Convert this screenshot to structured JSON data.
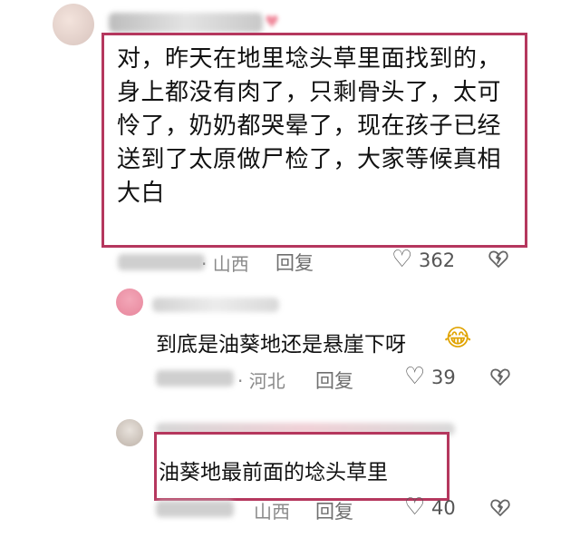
{
  "comments": [
    {
      "text": "对，昨天在地里埝头草里面找到的，身上都没有肉了，只剩骨头了，太可怜了，奶奶都哭晕了，现在孩子已经送到了太原做尸检了，大家等候真相大白",
      "location": "· 山西",
      "reply_label": "回复",
      "likes": "362",
      "like_icon": "heart-icon",
      "dislike_icon": "broken-heart-icon"
    },
    {
      "text": "到底是油葵地还是悬崖下呀",
      "emoji": "😂",
      "location": "· 河北",
      "reply_label": "回复",
      "likes": "39",
      "like_icon": "heart-icon",
      "dislike_icon": "broken-heart-icon"
    },
    {
      "text": "油葵地最前面的埝头草里",
      "location": "山西",
      "reply_label": "回复",
      "likes": "40",
      "like_icon": "heart-icon",
      "dislike_icon": "broken-heart-icon"
    }
  ],
  "colors": {
    "highlight_border": "#b5375e",
    "meta_text": "#8a8a8a"
  }
}
